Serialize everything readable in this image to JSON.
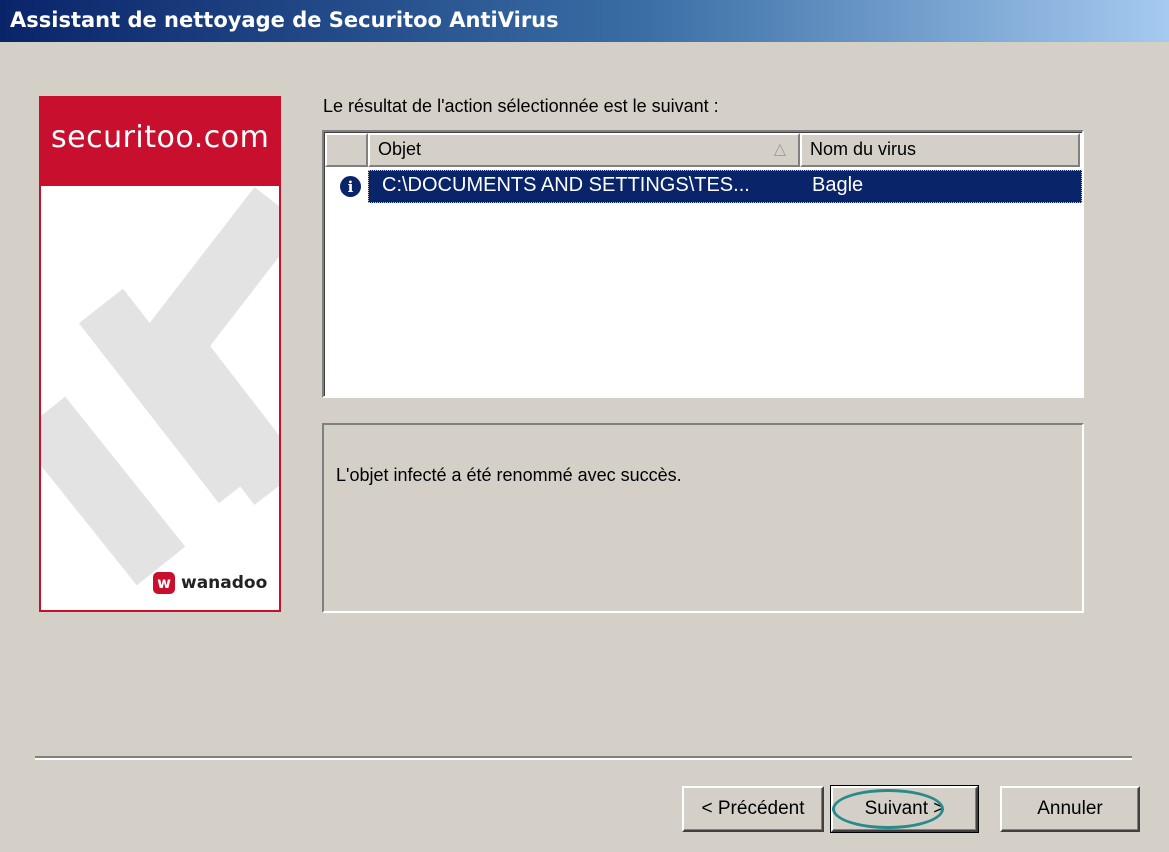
{
  "window": {
    "title": "Assistant de nettoyage de Securitoo AntiVirus"
  },
  "side_panel": {
    "brand": "securitoo.com",
    "logo_text": "wanadoo",
    "logo_mark": "w"
  },
  "result": {
    "label": "Le résultat de l'action sélectionnée est le suivant :",
    "columns": {
      "object": "Objet",
      "virus": "Nom du virus"
    },
    "rows": [
      {
        "icon": "info-icon",
        "object": "C:\\DOCUMENTS AND SETTINGS\\TES...",
        "virus": "Bagle"
      }
    ]
  },
  "message": "L'objet infecté a été renommé avec succès.",
  "buttons": {
    "previous": "< Précédent",
    "next": "Suivant >",
    "cancel": "Annuler"
  },
  "colors": {
    "brand_red": "#c8102e",
    "selection": "#0a246a",
    "highlight": "#2a8a8a"
  }
}
